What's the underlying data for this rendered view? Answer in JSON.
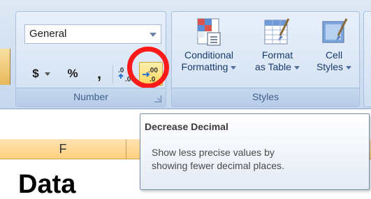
{
  "number_group": {
    "format_value": "General",
    "currency_label": "$",
    "percent_label": "%",
    "comma_label": ",",
    "label": "Number"
  },
  "styles_group": {
    "conditional_formatting": [
      "Conditional",
      "Formatting"
    ],
    "format_as_table": [
      "Format",
      "as Table"
    ],
    "cell_styles": [
      "Cell",
      "Styles"
    ],
    "label": "Styles"
  },
  "tooltip": {
    "title": "Decrease Decimal",
    "body_line1": "Show less precise values by",
    "body_line2": "showing fewer decimal places."
  },
  "sheet": {
    "column_header": "F",
    "cell_text": "Data"
  },
  "colors": {
    "highlight": "#ff1a1a",
    "ribbon": "#d3e1f1",
    "active_button": "#ffd75a"
  }
}
